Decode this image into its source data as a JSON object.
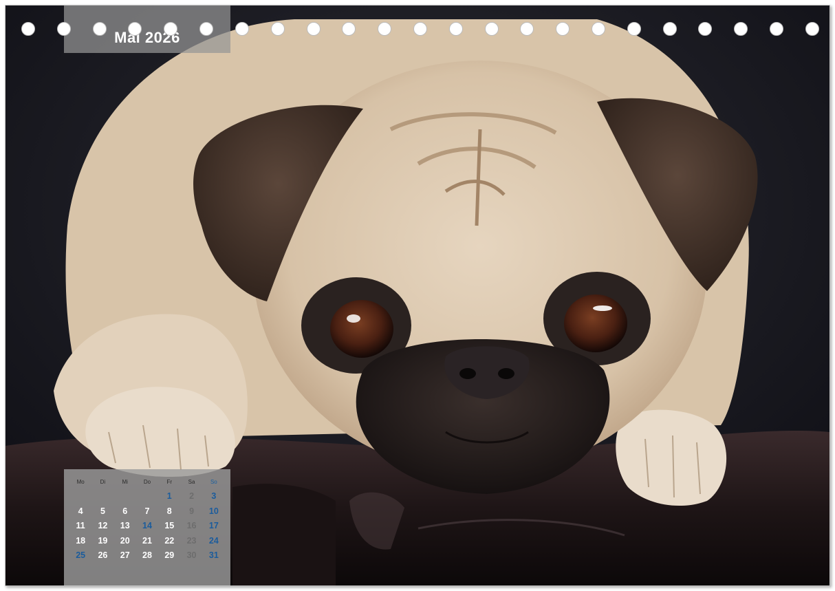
{
  "calendar_page": {
    "month_title": "Mai 2026",
    "weekday_headers": [
      "Mo",
      "Di",
      "Mi",
      "Do",
      "Fr",
      "Sa",
      "So"
    ],
    "weeks": [
      [
        {
          "day": ""
        },
        {
          "day": ""
        },
        {
          "day": ""
        },
        {
          "day": ""
        },
        {
          "day": "1",
          "style": "blue"
        },
        {
          "day": "2",
          "style": "gray"
        },
        {
          "day": "3",
          "style": "blue"
        }
      ],
      [
        {
          "day": "4"
        },
        {
          "day": "5"
        },
        {
          "day": "6"
        },
        {
          "day": "7"
        },
        {
          "day": "8"
        },
        {
          "day": "9",
          "style": "gray"
        },
        {
          "day": "10",
          "style": "blue"
        }
      ],
      [
        {
          "day": "11"
        },
        {
          "day": "12"
        },
        {
          "day": "13"
        },
        {
          "day": "14",
          "style": "blue"
        },
        {
          "day": "15"
        },
        {
          "day": "16",
          "style": "gray"
        },
        {
          "day": "17",
          "style": "blue"
        }
      ],
      [
        {
          "day": "18"
        },
        {
          "day": "19"
        },
        {
          "day": "20"
        },
        {
          "day": "21"
        },
        {
          "day": "22"
        },
        {
          "day": "23",
          "style": "gray"
        },
        {
          "day": "24",
          "style": "blue"
        }
      ],
      [
        {
          "day": "25",
          "style": "blue"
        },
        {
          "day": "26"
        },
        {
          "day": "27"
        },
        {
          "day": "28"
        },
        {
          "day": "29"
        },
        {
          "day": "30",
          "style": "gray"
        },
        {
          "day": "31",
          "style": "blue"
        }
      ]
    ],
    "binding_hole_count": 23,
    "photo_subject": "pug-photo",
    "colors": {
      "holiday_blue": "#1b5c9c",
      "saturday_gray": "#6d6d6d",
      "weekday_white": "#ffffff",
      "panel_gray": "#9b9b9b"
    }
  }
}
